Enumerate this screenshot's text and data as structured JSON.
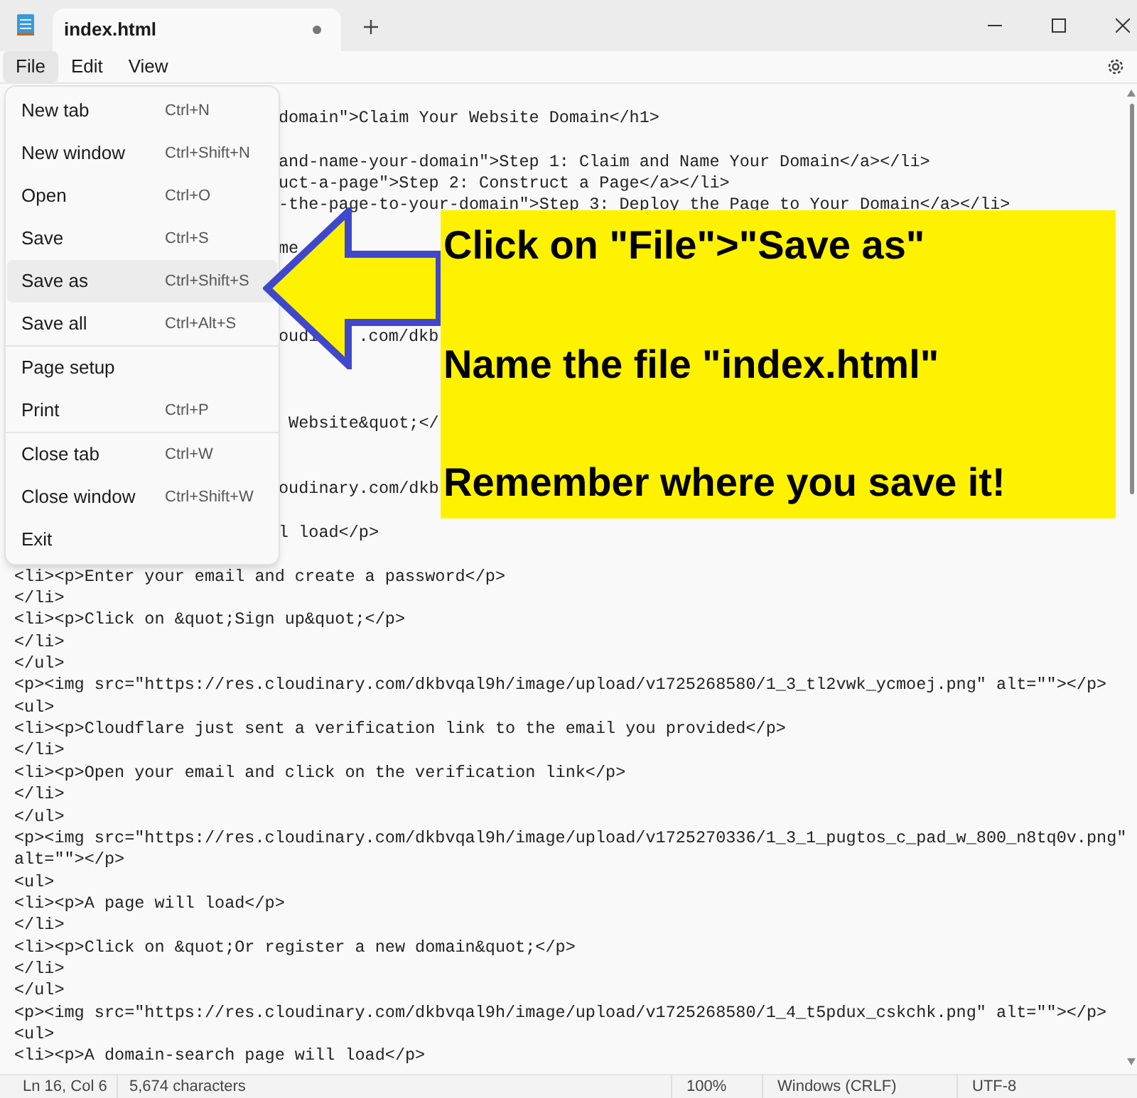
{
  "tab": {
    "title": "index.html",
    "modified": true
  },
  "menu_bar": [
    {
      "label": "File",
      "selected": true
    },
    {
      "label": "Edit",
      "selected": false
    },
    {
      "label": "View",
      "selected": false
    }
  ],
  "file_menu": [
    {
      "kind": "item",
      "label": "New tab",
      "shortcut": "Ctrl+N",
      "selected": false
    },
    {
      "kind": "item",
      "label": "New window",
      "shortcut": "Ctrl+Shift+N",
      "selected": false
    },
    {
      "kind": "item",
      "label": "Open",
      "shortcut": "Ctrl+O",
      "selected": false
    },
    {
      "kind": "item",
      "label": "Save",
      "shortcut": "Ctrl+S",
      "selected": false
    },
    {
      "kind": "item",
      "label": "Save as",
      "shortcut": "Ctrl+Shift+S",
      "selected": true
    },
    {
      "kind": "item",
      "label": "Save all",
      "shortcut": "Ctrl+Alt+S",
      "selected": false
    },
    {
      "kind": "separator"
    },
    {
      "kind": "item",
      "label": "Page setup",
      "selected": false
    },
    {
      "kind": "item",
      "label": "Print",
      "shortcut": "Ctrl+P",
      "selected": false
    },
    {
      "kind": "separator"
    },
    {
      "kind": "item",
      "label": "Close tab",
      "shortcut": "Ctrl+W",
      "selected": false
    },
    {
      "kind": "item",
      "label": "Close window",
      "shortcut": "Ctrl+Shift+W",
      "selected": false
    },
    {
      "kind": "item",
      "label": "Exit",
      "selected": false
    }
  ],
  "editor_lines": [
    {
      "kind": "partial",
      "text": "domain\">Claim Your Website Domain</h1>"
    },
    {
      "kind": "blank"
    },
    {
      "kind": "partial",
      "text": "and-name-your-domain\">Step 1: Claim and Name Your Domain</a></li>"
    },
    {
      "kind": "partial",
      "text": "uct-a-page\">Step 2: Construct a Page</a></li>"
    },
    {
      "kind": "partial",
      "text": "-the-page-to-your-domain\">Step 3: Deploy the Page to Your Domain</a></li>"
    },
    {
      "kind": "blank"
    },
    {
      "kind": "partial",
      "text": "me"
    },
    {
      "kind": "blank"
    },
    {
      "kind": "blank"
    },
    {
      "kind": "blank"
    },
    {
      "kind": "split",
      "parts": [
        "oudi",
        ".com/dkb"
      ]
    },
    {
      "kind": "blank"
    },
    {
      "kind": "blank"
    },
    {
      "kind": "blank"
    },
    {
      "kind": "partial",
      "text": " Website&quot;</"
    },
    {
      "kind": "blank"
    },
    {
      "kind": "blank"
    },
    {
      "kind": "partial",
      "text": "oudinary.com/dkb"
    },
    {
      "kind": "blank"
    },
    {
      "kind": "partial",
      "text": "l load</p>"
    },
    {
      "kind": "blank"
    },
    {
      "kind": "full",
      "text": "<li><p>Enter your email and create a password</p>"
    },
    {
      "kind": "full",
      "text": "</li>"
    },
    {
      "kind": "full",
      "text": "<li><p>Click on &quot;Sign up&quot;</p>"
    },
    {
      "kind": "full",
      "text": "</li>"
    },
    {
      "kind": "full",
      "text": "</ul>"
    },
    {
      "kind": "full",
      "text": "<p><img src=\"https://res.cloudinary.com/dkbvqal9h/image/upload/v1725268580/1_3_tl2vwk_ycmoej.png\" alt=\"\"></p>"
    },
    {
      "kind": "full",
      "text": "<ul>"
    },
    {
      "kind": "full",
      "text": "<li><p>Cloudflare just sent a verification link to the email you provided</p>"
    },
    {
      "kind": "full",
      "text": "</li>"
    },
    {
      "kind": "full",
      "text": "<li><p>Open your email and click on the verification link</p>"
    },
    {
      "kind": "full",
      "text": "</li>"
    },
    {
      "kind": "full",
      "text": "</ul>"
    },
    {
      "kind": "full",
      "text": "<p><img src=\"https://res.cloudinary.com/dkbvqal9h/image/upload/v1725270336/1_3_1_pugtos_c_pad_w_800_n8tq0v.png\""
    },
    {
      "kind": "full",
      "text": "alt=\"\"></p>"
    },
    {
      "kind": "full",
      "text": "<ul>"
    },
    {
      "kind": "full",
      "text": "<li><p>A page will load</p>"
    },
    {
      "kind": "full",
      "text": "</li>"
    },
    {
      "kind": "full",
      "text": "<li><p>Click on &quot;Or register a new domain&quot;</p>"
    },
    {
      "kind": "full",
      "text": "</li>"
    },
    {
      "kind": "full",
      "text": "</ul>"
    },
    {
      "kind": "full",
      "text": "<p><img src=\"https://res.cloudinary.com/dkbvqal9h/image/upload/v1725268580/1_4_t5pdux_cskchk.png\" alt=\"\"></p>"
    },
    {
      "kind": "full",
      "text": "<ul>"
    },
    {
      "kind": "full",
      "text": "<li><p>A domain-search page will load</p>"
    }
  ],
  "callout": [
    "Click on \"File\">\"Save as\"",
    "Name the file \"index.html\"",
    "Remember where you save it!"
  ],
  "status_bar": {
    "position": "Ln 16, Col 6",
    "characters": "5,674 characters",
    "zoom": "100%",
    "line_ending": "Windows (CRLF)",
    "encoding": "UTF-8"
  }
}
